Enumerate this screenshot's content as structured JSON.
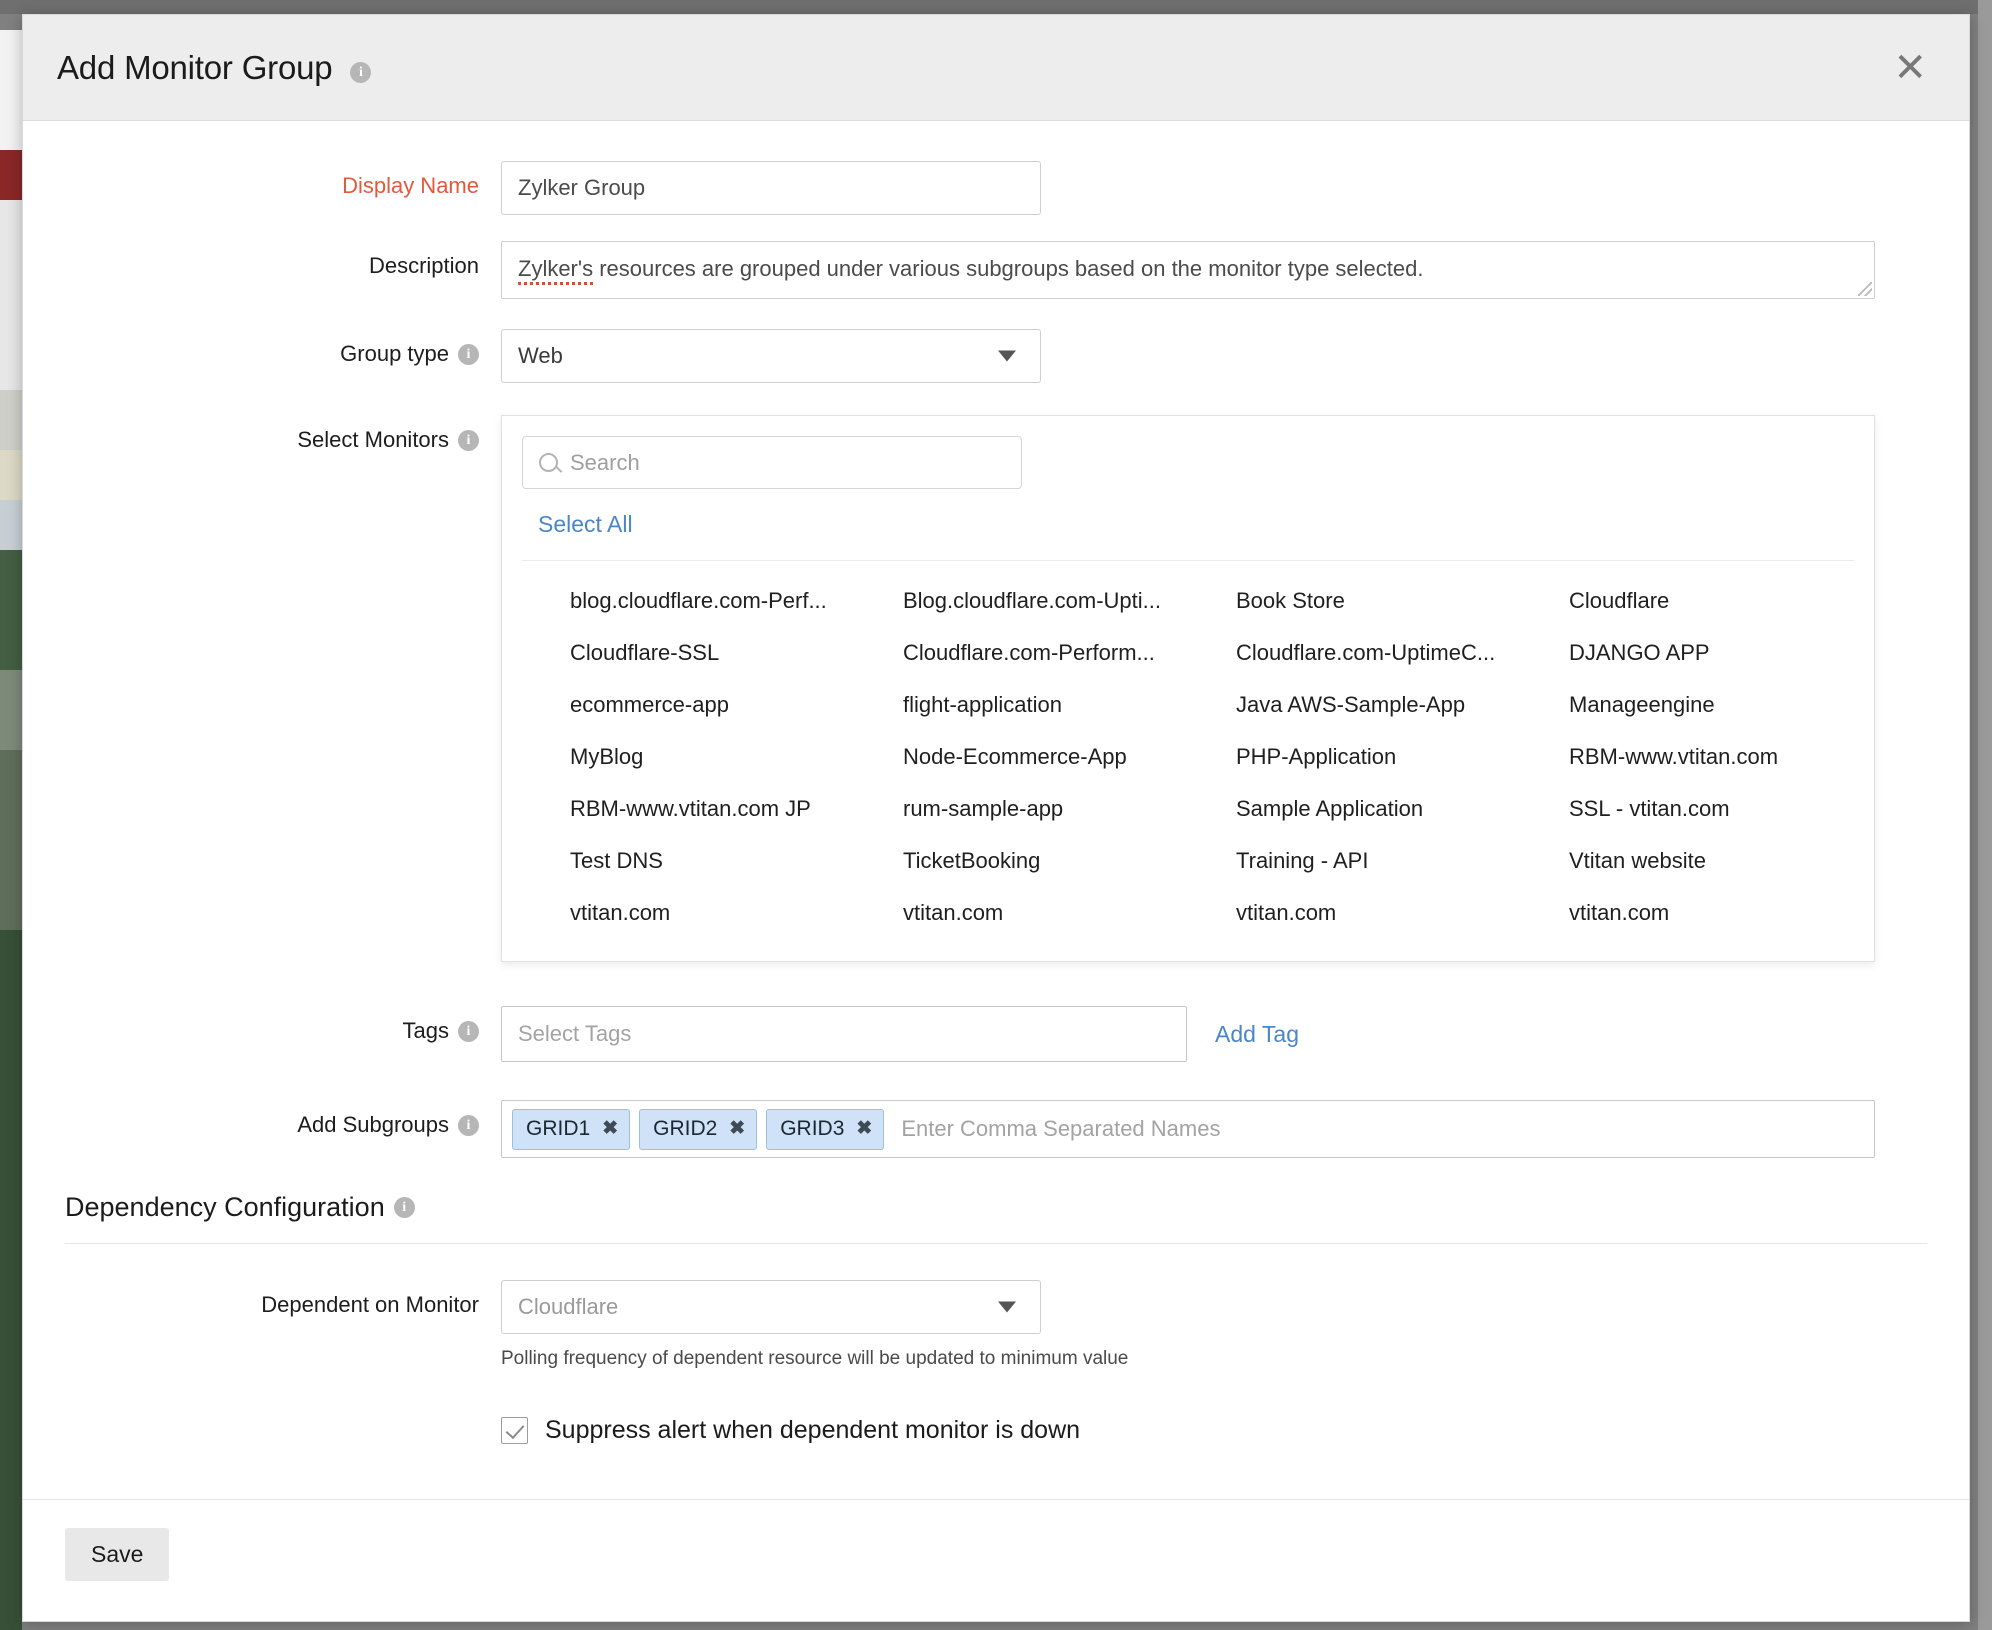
{
  "dialog": {
    "title": "Add Monitor Group",
    "close_icon": "close-icon",
    "info_icon": "i"
  },
  "fields": {
    "display_name": {
      "label": "Display Name",
      "value": "Zylker Group"
    },
    "description": {
      "label": "Description",
      "misspelled_word": "Zylker's",
      "value": " resources are grouped under  various subgroups based on the monitor type selected."
    },
    "group_type": {
      "label": "Group type",
      "value": "Web"
    },
    "select_monitors": {
      "label": "Select Monitors",
      "search_placeholder": "Search",
      "search_value": "",
      "select_all_label": "Select All",
      "monitors": [
        "blog.cloudflare.com-Perf...",
        "Blog.cloudflare.com-Upti...",
        "Book Store",
        "Cloudflare",
        "Cloudflare-SSL",
        "Cloudflare.com-Perform...",
        "Cloudflare.com-UptimeC...",
        "DJANGO APP",
        "ecommerce-app",
        "flight-application",
        "Java AWS-Sample-App",
        "Manageengine",
        "MyBlog",
        "Node-Ecommerce-App",
        "PHP-Application",
        "RBM-www.vtitan.com",
        "RBM-www.vtitan.com JP",
        "rum-sample-app",
        "Sample Application",
        "SSL - vtitan.com",
        "Test DNS",
        "TicketBooking",
        "Training - API",
        "Vtitan website",
        "vtitan.com",
        "vtitan.com",
        "vtitan.com",
        "vtitan.com"
      ]
    },
    "tags": {
      "label": "Tags",
      "placeholder": "Select Tags",
      "value": "",
      "add_tag_label": "Add Tag"
    },
    "subgroups": {
      "label": "Add Subgroups",
      "chips": [
        "GRID1",
        "GRID2",
        "GRID3"
      ],
      "placeholder": "Enter Comma Separated Names",
      "remove_icon": "✖"
    }
  },
  "dependency": {
    "heading": "Dependency Configuration",
    "monitor_label": "Dependent on Monitor",
    "monitor_value": "Cloudflare",
    "help_text": "Polling frequency of dependent resource will be updated to minimum value",
    "suppress_label": "Suppress alert when dependent monitor is down",
    "suppress_checked": true
  },
  "footer": {
    "save_label": "Save"
  },
  "colors": {
    "required_label": "#e2593d",
    "link": "#4a86c8",
    "chip_bg": "#cfe2f7",
    "header_bg": "#ededed"
  }
}
